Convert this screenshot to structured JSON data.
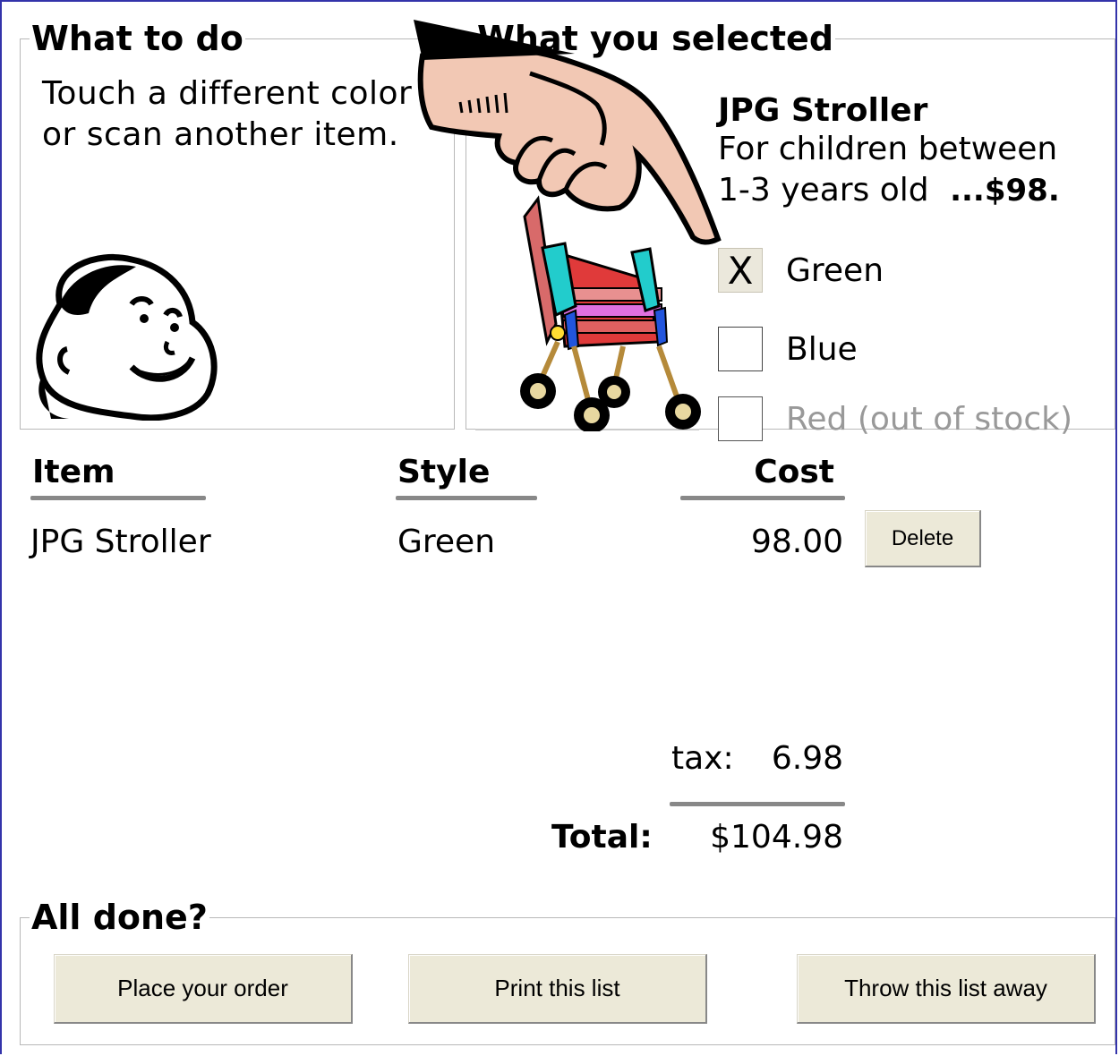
{
  "instructions": {
    "legend": "What to do",
    "line1": "Touch a different color",
    "line2": "or scan another item."
  },
  "selection": {
    "legend": "What you selected",
    "product_name": "JPG Stroller",
    "desc_line1": "For children between",
    "desc_line2": "1-3 years old",
    "price": "...$98.",
    "options": [
      {
        "label": "Green",
        "checked": true,
        "mark": "X"
      },
      {
        "label": "Blue",
        "checked": false
      },
      {
        "label": "Red (out of stock)",
        "checked": false,
        "disabled": true
      }
    ]
  },
  "table": {
    "headers": {
      "item": "Item",
      "style": "Style",
      "cost": "Cost"
    },
    "rows": [
      {
        "item": "JPG Stroller",
        "style": "Green",
        "cost": "98.00",
        "action": "Delete"
      }
    ],
    "tax_label": "tax:",
    "tax_value": "6.98",
    "total_label": "Total:",
    "total_value": "$104.98"
  },
  "done": {
    "legend": "All done?",
    "place_order": "Place your order",
    "print_list": "Print this list",
    "throw_away": "Throw this list away"
  },
  "colors": {
    "frame": "#3333aa",
    "button_face": "#ece9d8",
    "rule": "#888888"
  }
}
